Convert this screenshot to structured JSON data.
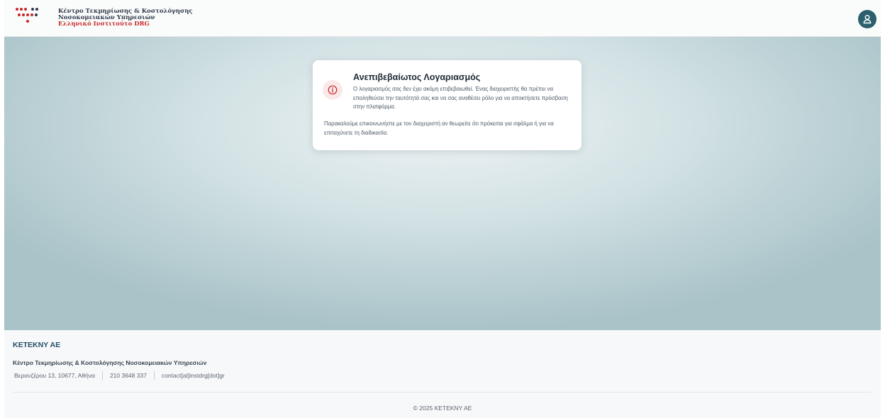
{
  "header": {
    "logo": {
      "line1": "Κέντρο Τεκμηρίωσης & Κοστολόγησης",
      "line2": "Νοσοκομειακών Υπηρεσιών",
      "line3": "Ελληνικό Ινστιτούτο DRG"
    },
    "user_icon": "user-icon"
  },
  "alert": {
    "icon": "info-icon",
    "title": "Ανεπιβεβαίωτος Λογαριασμός",
    "message": "Ο λογαριασμός σας δεν έχει ακόμη επιβεβαιωθεί. Ένας διαχειριστής θα πρέπει να επαληθεύσει την ταυτότητά σας και να σας αναθέσει ρόλο για να αποκτήσετε πρόσβαση στην πλατφόρμα.",
    "note": "Παρακαλούμε επικοινωνήστε με τον διαχειριστή αν θεωρείτε ότι πρόκειται για σφάλμα ή για να επιταχύνετε τη διαδικασία."
  },
  "footer": {
    "company": "KETEKNY AE",
    "full_name": "Κέντρο Τεκμηρίωσης & Κοστολόγησης Νοσοκομειακών Υπηρεσιών",
    "address": "Βερανζέρου 13, 10677, Αθήνα",
    "phone": "210 3648 337",
    "email": "contact[at]instdrg[dot]gr",
    "copyright": "© 2025 KETEKNY AE"
  },
  "colors": {
    "brand": "#2b5f6d",
    "alert_accent": "#c62828",
    "footer_title": "#24506a"
  }
}
